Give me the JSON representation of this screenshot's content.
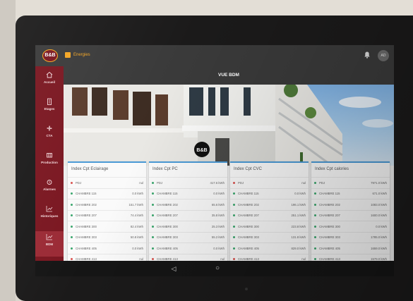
{
  "header": {
    "logo_text": "B&B",
    "breadcrumb": "Energies",
    "avatar": "AD",
    "page_title": "VUE BDM"
  },
  "sidebar": {
    "items": [
      {
        "label": "Accueil",
        "icon": "home-icon"
      },
      {
        "label": "Etages",
        "icon": "building-icon"
      },
      {
        "label": "CTA",
        "icon": "fan-icon"
      },
      {
        "label": "Production",
        "icon": "heater-icon"
      },
      {
        "label": "Alarmes",
        "icon": "alarm-icon"
      },
      {
        "label": "Historiques",
        "icon": "chart-icon"
      },
      {
        "label": "BDM",
        "icon": "chart-icon",
        "active": true
      }
    ]
  },
  "hero": {
    "sign": "B&B"
  },
  "cards": [
    {
      "title": "Index Cpt Eclairage",
      "rows": [
        {
          "name": "PDJ",
          "value": "nul",
          "status": "red"
        },
        {
          "name": "CHAMBRE 115",
          "value": "0.0 kWh",
          "status": "green"
        },
        {
          "name": "CHAMBRE 202",
          "value": "151.7 kWh",
          "status": "green"
        },
        {
          "name": "CHAMBRE 207",
          "value": "74.4 kWh",
          "status": "green"
        },
        {
          "name": "CHAMBRE 300",
          "value": "82.4 kWh",
          "status": "green"
        },
        {
          "name": "CHAMBRE 303",
          "value": "50.8 kWh",
          "status": "green"
        },
        {
          "name": "CHAMBRE 405",
          "value": "0.0 kWh",
          "status": "green"
        },
        {
          "name": "CHAMBRE 413",
          "value": "nul",
          "status": "red"
        }
      ]
    },
    {
      "title": "Index Cpt PC",
      "rows": [
        {
          "name": "PDJ",
          "value": "417.6 kWh",
          "status": "green"
        },
        {
          "name": "CHAMBRE 115",
          "value": "0.0 kWh",
          "status": "green"
        },
        {
          "name": "CHAMBRE 202",
          "value": "65.6 kWh",
          "status": "green"
        },
        {
          "name": "CHAMBRE 207",
          "value": "35.8 kWh",
          "status": "green"
        },
        {
          "name": "CHAMBRE 300",
          "value": "25.3 kWh",
          "status": "green"
        },
        {
          "name": "CHAMBRE 303",
          "value": "55.2 kWh",
          "status": "green"
        },
        {
          "name": "CHAMBRE 405",
          "value": "0.0 kWh",
          "status": "green"
        },
        {
          "name": "CHAMBRE 413",
          "value": "nul",
          "status": "red"
        }
      ]
    },
    {
      "title": "Index Cpt CVC",
      "rows": [
        {
          "name": "PDJ",
          "value": "nul",
          "status": "red"
        },
        {
          "name": "CHAMBRE 115",
          "value": "0.0 kWh",
          "status": "green"
        },
        {
          "name": "CHAMBRE 202",
          "value": "196.1 kWh",
          "status": "green"
        },
        {
          "name": "CHAMBRE 207",
          "value": "251.1 kWh",
          "status": "green"
        },
        {
          "name": "CHAMBRE 300",
          "value": "223.8 kWh",
          "status": "green"
        },
        {
          "name": "CHAMBRE 303",
          "value": "131.8 kWh",
          "status": "green"
        },
        {
          "name": "CHAMBRE 405",
          "value": "829.0 kWh",
          "status": "green"
        },
        {
          "name": "CHAMBRE 413",
          "value": "nul",
          "status": "red"
        }
      ]
    },
    {
      "title": "Index Cpt calories",
      "rows": [
        {
          "name": "PDJ",
          "value": "7971.0 kWh",
          "status": "green"
        },
        {
          "name": "CHAMBRE 115",
          "value": "671.0 kWh",
          "status": "green"
        },
        {
          "name": "CHAMBRE 202",
          "value": "1083.0 kWh",
          "status": "green"
        },
        {
          "name": "CHAMBRE 207",
          "value": "1600.0 kWh",
          "status": "green"
        },
        {
          "name": "CHAMBRE 300",
          "value": "0.0 kWh",
          "status": "green"
        },
        {
          "name": "CHAMBRE 303",
          "value": "1785.0 kWh",
          "status": "green"
        },
        {
          "name": "CHAMBRE 405",
          "value": "1659.0 kWh",
          "status": "green"
        },
        {
          "name": "CHAMBRE 413",
          "value": "1579.0 kWh",
          "status": "green"
        }
      ]
    }
  ],
  "colors": {
    "brand": "#7a1620",
    "accent": "#f5a623",
    "card_accent": "#4a9ad6",
    "status_green": "#3aa76d",
    "status_red": "#d9534f"
  },
  "android_nav": {
    "back": "◁",
    "home": "○"
  }
}
